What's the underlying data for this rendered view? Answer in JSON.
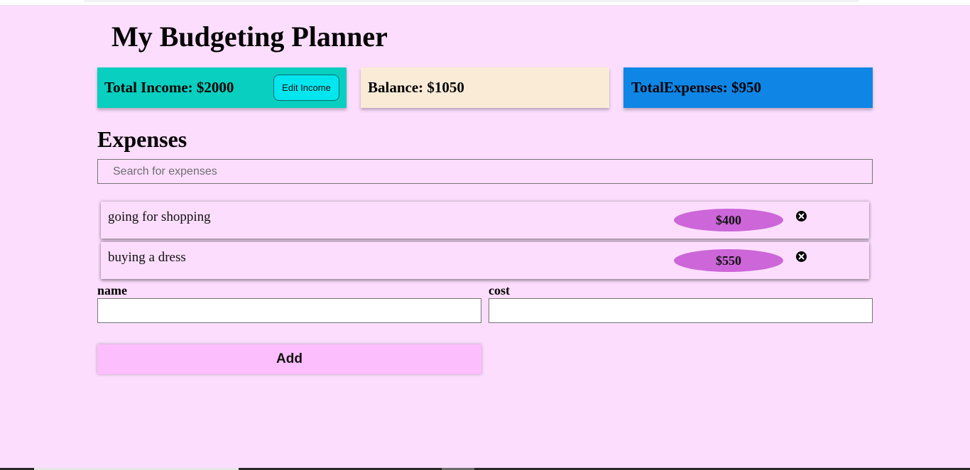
{
  "app": {
    "title": "My Budgeting Planner"
  },
  "summary": {
    "income_text": "Total Income: $2000",
    "edit_income_label": "Edit Income",
    "balance_text": "Balance: $1050",
    "expenses_text": "TotalExpenses: $950"
  },
  "colors": {
    "page_bg": "#fcddfd",
    "income_card": "#08cfc0",
    "edit_button": "#00e6ee",
    "balance_card": "#faebd7",
    "expenses_card": "#0f86e6",
    "cost_pill": "#cc66d9",
    "add_button": "#fdbefd"
  },
  "expenses_section": {
    "title": "Expenses",
    "search": {
      "placeholder": "Search for expenses",
      "value": ""
    },
    "items": [
      {
        "name": "going for shopping",
        "cost": "$400",
        "delete_icon": "close-circle-icon"
      },
      {
        "name": "buying a dress",
        "cost": "$550",
        "delete_icon": "close-circle-icon"
      }
    ]
  },
  "form": {
    "name_label": "name",
    "name_value": "",
    "cost_label": "cost",
    "cost_value": "",
    "add_label": "Add"
  }
}
